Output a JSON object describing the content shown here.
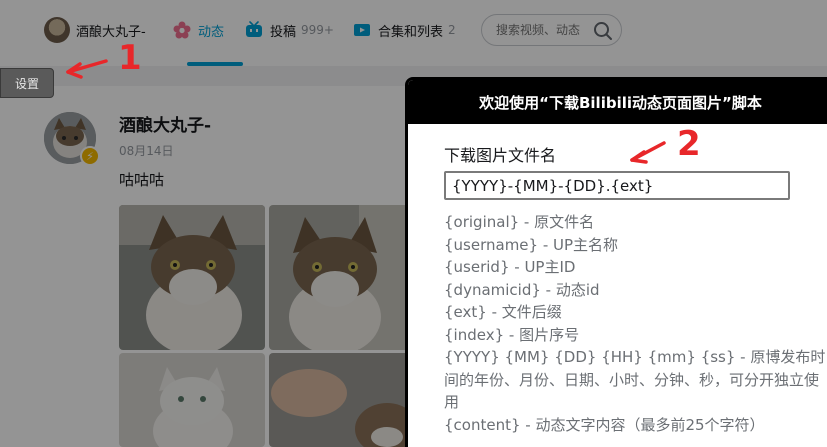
{
  "nav": {
    "user_name": "酒酿大丸子-",
    "tabs": [
      {
        "label": "动态",
        "icon": "flower-icon",
        "active": true
      },
      {
        "label": "投稿",
        "icon": "tv-icon",
        "count": "999+"
      },
      {
        "label": "合集和列表",
        "icon": "playlist-icon",
        "count": "2"
      }
    ],
    "search_placeholder": "搜索视频、动态"
  },
  "settings_button": "设置",
  "post": {
    "author": "酒酿大丸子-",
    "date": "08月14日",
    "text": "咕咕咕"
  },
  "dialog": {
    "title": "欢迎使用“下载Bilibili动态页面图片”脚本",
    "field_label": "下载图片文件名",
    "filename_value": "{YYYY}-{MM}-{DD}.{ext}",
    "help_lines": [
      "{original} - 原文件名",
      "{username} - UP主名称",
      "{userid} - UP主ID",
      "{dynamicid} - 动态id",
      "{ext} - 文件后缀",
      "{index} - 图片序号",
      "{YYYY} {MM} {DD} {HH} {mm} {ss} - 原博发布时间的年份、月份、日期、小时、分钟、秒，可分开独立使用",
      "{content} - 动态文字内容（最多前25个字符）"
    ]
  },
  "annotations": [
    "1",
    "2"
  ],
  "colors": {
    "accent": "#00a1d6",
    "annotation": "#e8272a",
    "dialog_header": "#000000"
  }
}
